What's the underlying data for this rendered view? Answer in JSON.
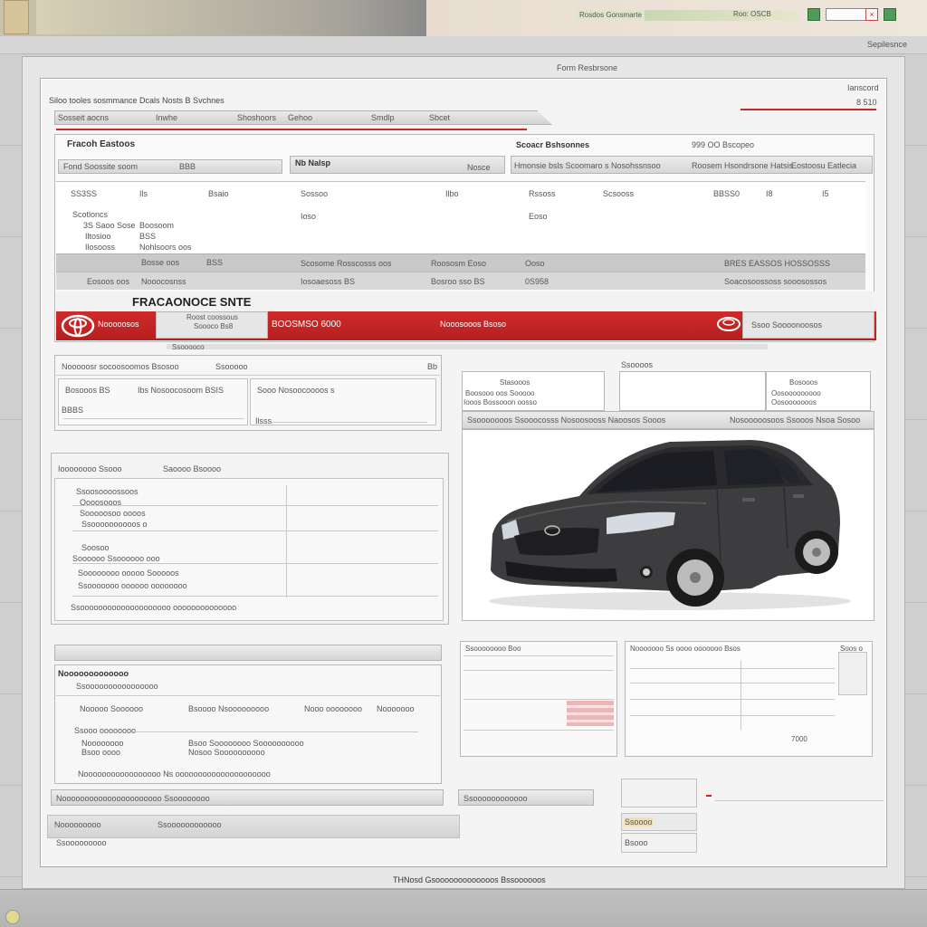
{
  "taskbar": {
    "status_text": "Rosdos Gonsmarte",
    "status_code": "Roo: OSCB",
    "tray_icons": [
      "green-square-icon",
      "window-icon",
      "close-icon",
      "green-square-icon"
    ]
  },
  "toolbar": {
    "right_text": "Sepilesnce"
  },
  "window": {
    "title": "Form Resbrsone"
  },
  "form": {
    "header_left": "Siloo tooles sosmmance Dcals Nosts B Svchnes",
    "header_right_top": "Ianscord",
    "header_right_num": "8 510",
    "tabs": [
      "Sosseit aocns",
      "Inwhe",
      "Shoshoors",
      "Gehoo",
      "Smdlp",
      "Sbcet"
    ],
    "vehicle_section": {
      "title": "Fracoh Eastoos",
      "field1": "Fond Soossite soom",
      "field1_suffix": "BBB",
      "field2": "Nb Nalsp",
      "field3": "Nosce",
      "right_title": "Scoacr Bshsonnes",
      "right_subtitle": "999 OO Bscopeo",
      "col_headers": [
        "Hmonsie bsls Scoomaro s Nosohssnsoo",
        "Roosem Hsondrsone Hatsis",
        "Eostoosu Eatlecia"
      ],
      "rows": [
        [
          "SS3SS",
          "Ils",
          "Bsaio",
          "Sossoo",
          "Ilbo",
          "Rssoss",
          "Scsooss",
          "BBSS0",
          "I8",
          "I5"
        ],
        [
          "Scotloncs",
          "",
          "",
          "Ioso",
          "",
          "Eoso",
          "",
          "",
          "",
          ""
        ],
        [
          "3S Saoo Sose",
          "Boosoom",
          "",
          "",
          "",
          "",
          "",
          "",
          "",
          ""
        ],
        [
          "Iltosioo",
          "BSS",
          "",
          "",
          "",
          "",
          "",
          "",
          "",
          ""
        ],
        [
          "Ilosooss",
          "Nohlsoors oos",
          "",
          "",
          "",
          "",
          "",
          "",
          "",
          ""
        ]
      ],
      "gray_rows": [
        [
          "Bosse oos",
          "BSS",
          "Scosome Rosscosss oos",
          "Roososm Eoso",
          "Ooso",
          "BRES EASSOS HOSSOSSS"
        ],
        [
          "Eosoos oos",
          "Nooocosnss",
          "Iosoaesoss BS",
          "Bosroo sso BS",
          "0S958",
          "Soacosoossoss sooosossos"
        ]
      ]
    },
    "banner": {
      "title": "FRACAONOCE SNTE",
      "left_label": "Nooooosos",
      "box_top": "Roost coossous",
      "box_bottom": "Soooco Bs8",
      "code": "BOOSMSO 6000",
      "center": "Nooosooos Bsoso",
      "right_box": "Ssoo Soooonoosos"
    },
    "details": {
      "header": "Ssooooco",
      "row1_left": "Nooooosr socoosoomos Bsosoo",
      "row1_right": "Ssooooo",
      "row1_num": "Bb",
      "sub1": "Bosooos BS",
      "sub2": "Ibs Nosoocosoom BSIS",
      "sub3": "Sooo Nosoocoooos s",
      "sub4": "BBBS",
      "sub5": "Ilsss"
    },
    "car_panel": {
      "top_left_a": "Stasooos",
      "top_left_b": "Boosooo oos Sooooo",
      "top_left_c": "Iooos Bossooon oosso",
      "top_mid": "Ssoooos",
      "top_right_a": "Bosooos",
      "top_right_b": "Oosooooooooo",
      "top_right_c": "Oosooooooos",
      "caption_left": "Ssooooooos Ssooocosss Nosoosooss Naoosos Sooos",
      "caption_right": "Nosooooosoos Ssooos Nsoa Sosoo"
    },
    "mid_panel": {
      "title": "Ioooooooo Ssooo",
      "subtitle": "Saoooo Bsoooo",
      "items": [
        "Ssoosoooossoos",
        "Oooosooos",
        "Sooooosoo oooos",
        "Ssoooooooooos o",
        "Soosoo",
        "Soooooo Ssoooooo ooo",
        "Soooooooo ooooo Sooooos",
        "Ssooooooo oooooo oooooooo"
      ],
      "footer": "Ssoooooooooooooooooooo oooooooooooooo"
    },
    "lower_panel": {
      "title": "Nooooooooooooo",
      "subtitle": "Ssoooooooooooooooo",
      "headers": [
        "Nooooo Soooooo",
        "Bsoooo Nsooooooooo",
        "Nooo oooooooo",
        "Nooooooo"
      ],
      "rows": [
        [
          "Ssooo oooooooo",
          "",
          "",
          ""
        ],
        [
          "Noooooooo",
          "Bsoo Soooooooo Soooooooooo",
          "",
          ""
        ],
        [
          "Bsoo oooo",
          "Nosoo Soooooooooo",
          "",
          ""
        ]
      ],
      "footer": "Nooooooooooooooooo Ns ooooooooooooooooooooo"
    },
    "small_tables": {
      "a_title": "Ssoooooooo Boo",
      "b_title": "Nooooooo Ss oooo ooooooo Bsos",
      "b_right": "Soos o",
      "b_num": "7000"
    },
    "bottom": {
      "bar1": "Noooooooooooooooooooooo Ssoooooooo",
      "bar2": "Ssoooooooooooo",
      "row_a": "Nooooooooo",
      "row_b": "Ssoooooooooooo",
      "row_c": "Ssooooooooo",
      "btn1": "Ssoooo",
      "btn2": "Bsooo"
    },
    "footer": "THNosd Gsooooooooooooos Bssoooooos"
  }
}
